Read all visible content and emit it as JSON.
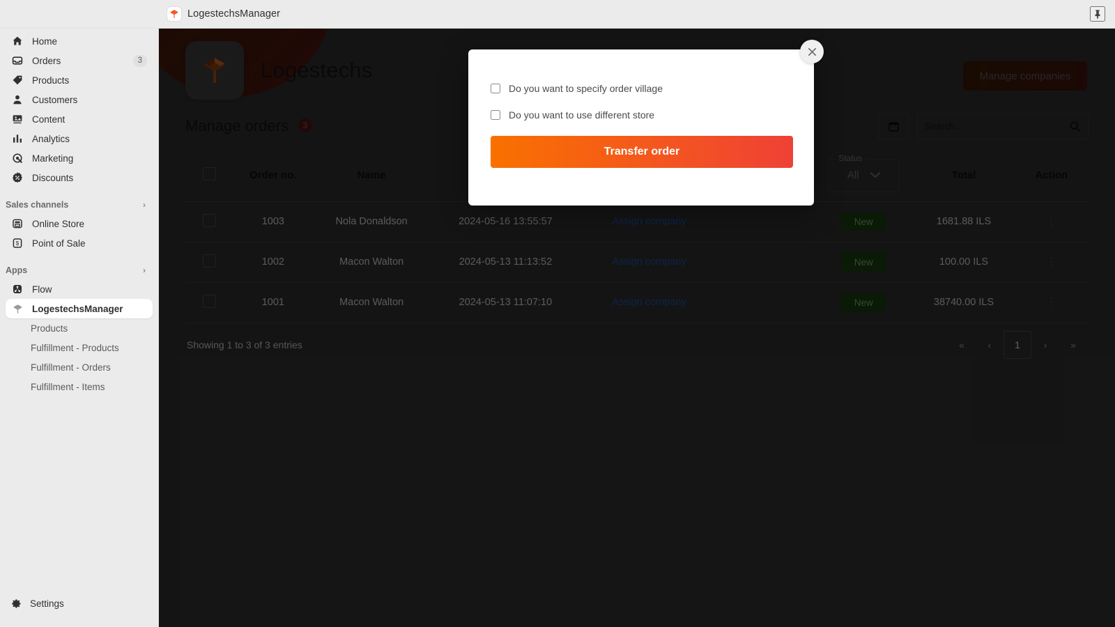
{
  "topbar": {
    "app_title": "LogestechsManager",
    "app_icon": "logestechs-logo-icon",
    "pin_icon": "pin-icon"
  },
  "sidebar": {
    "items": [
      {
        "label": "Home",
        "icon": "home-icon",
        "badge": ""
      },
      {
        "label": "Orders",
        "icon": "orders-inbox-icon",
        "badge": "3"
      },
      {
        "label": "Products",
        "icon": "tag-icon",
        "badge": ""
      },
      {
        "label": "Customers",
        "icon": "person-icon",
        "badge": ""
      },
      {
        "label": "Content",
        "icon": "content-image-icon",
        "badge": ""
      },
      {
        "label": "Analytics",
        "icon": "bar-chart-icon",
        "badge": ""
      },
      {
        "label": "Marketing",
        "icon": "target-icon",
        "badge": ""
      },
      {
        "label": "Discounts",
        "icon": "discount-badge-icon",
        "badge": ""
      }
    ],
    "sales_channels": {
      "label": "Sales channels",
      "chevron": "›",
      "items": [
        {
          "label": "Online Store",
          "icon": "storefront-icon"
        },
        {
          "label": "Point of Sale",
          "icon": "pos-icon"
        }
      ]
    },
    "apps": {
      "label": "Apps",
      "chevron": "›",
      "items": [
        {
          "label": "Flow",
          "icon": "flow-icon"
        },
        {
          "label": "LogestechsManager",
          "icon": "logestechs-logo-icon"
        }
      ],
      "sub_items": [
        {
          "label": "Products"
        },
        {
          "label": "Fulfillment - Products"
        },
        {
          "label": "Fulfillment - Orders"
        },
        {
          "label": "Fulfillment - Items"
        }
      ]
    },
    "settings": {
      "label": "Settings",
      "icon": "gear-icon"
    }
  },
  "hero": {
    "brand_name": "Logestechs",
    "logo_icon": "logestechs-cube-logo-icon",
    "manage_companies_label": "Manage companies"
  },
  "orders": {
    "title": "Manage orders",
    "count_badge": "3",
    "date_picker_icon": "calendar-icon",
    "search": {
      "placeholder": "Search...",
      "value": "",
      "icon": "search-icon"
    },
    "columns": {
      "order_no": "Order no.",
      "name": "Name",
      "date": "",
      "company": "",
      "status_filter_legend": "Status",
      "status_filter_value": "All",
      "status_filter_chevron": "chevron-down-icon",
      "total": "Total",
      "action": "Action"
    },
    "rows": [
      {
        "order_no": "1003",
        "name": "Nola Donaldson",
        "date": "2024-05-16 13:55:57",
        "company_link": "Assign company",
        "status": "New",
        "total": "1681.88 ILS",
        "action_icon": "kebab-menu-icon"
      },
      {
        "order_no": "1002",
        "name": "Macon Walton",
        "date": "2024-05-13 11:13:52",
        "company_link": "Assign company",
        "status": "New",
        "total": "100.00 ILS",
        "action_icon": "kebab-menu-icon"
      },
      {
        "order_no": "1001",
        "name": "Macon Walton",
        "date": "2024-05-13 11:07:10",
        "company_link": "Assign company",
        "status": "New",
        "total": "38740.00 ILS",
        "action_icon": "kebab-menu-icon"
      }
    ],
    "footer": {
      "entries_text": "Showing 1 to 3 of 3 entries",
      "pagination": {
        "first": "«",
        "prev": "‹",
        "current": "1",
        "next": "›",
        "last": "»"
      }
    }
  },
  "modal": {
    "close_icon": "close-icon",
    "checkbox_village_label": "Do you want to specify order village",
    "checkbox_store_label": "Do you want to use different store",
    "transfer_button_label": "Transfer order"
  },
  "colors": {
    "accent_orange": "#f97100",
    "accent_red": "#ef4136",
    "status_green_bg": "#143a0d",
    "link_blue": "#1d4fa3",
    "sidebar_bg": "#ebebeb",
    "main_bg": "#2e2e2e"
  }
}
